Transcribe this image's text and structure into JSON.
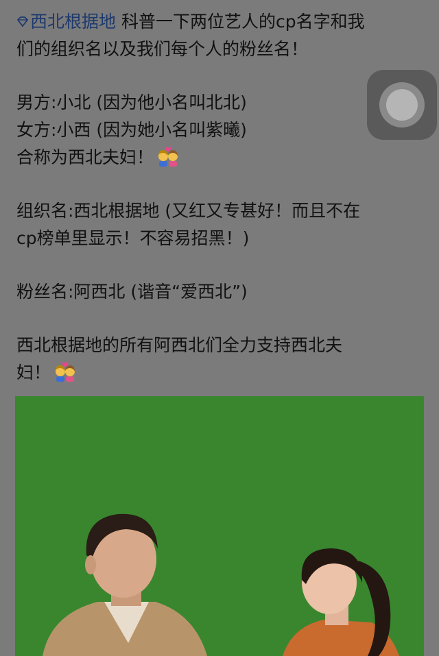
{
  "post": {
    "topic": "西北根据地",
    "line1_rest": " 科普一下两位艺人的cp名字和我",
    "line2": "们的组织名以及我们每个人的粉丝名！",
    "line3": "男方:小北 (因为他小名叫北北)",
    "line4": "女方:小西 (因为她小名叫紫曦)",
    "line5": "合称为西北夫妇！",
    "line6": "组织名:西北根据地 (又红又专甚好！而且不在",
    "line7": "cp榜单里显示！不容易招黑！)",
    "line8": "粉丝名:阿西北 (谐音“爱西北”)",
    "line9": "西北根据地的所有阿西北们全力支持西北夫",
    "line10": "妇！"
  },
  "icons": {
    "topic": "diamond-topic-icon",
    "emoji": "couple-with-heart-emoji",
    "assistive": "assistive-touch-icon"
  },
  "colors": {
    "overlay_gray": "#7b7b7b",
    "topic_blue": "#1e3a6e",
    "photo_green": "#3d8a32"
  }
}
